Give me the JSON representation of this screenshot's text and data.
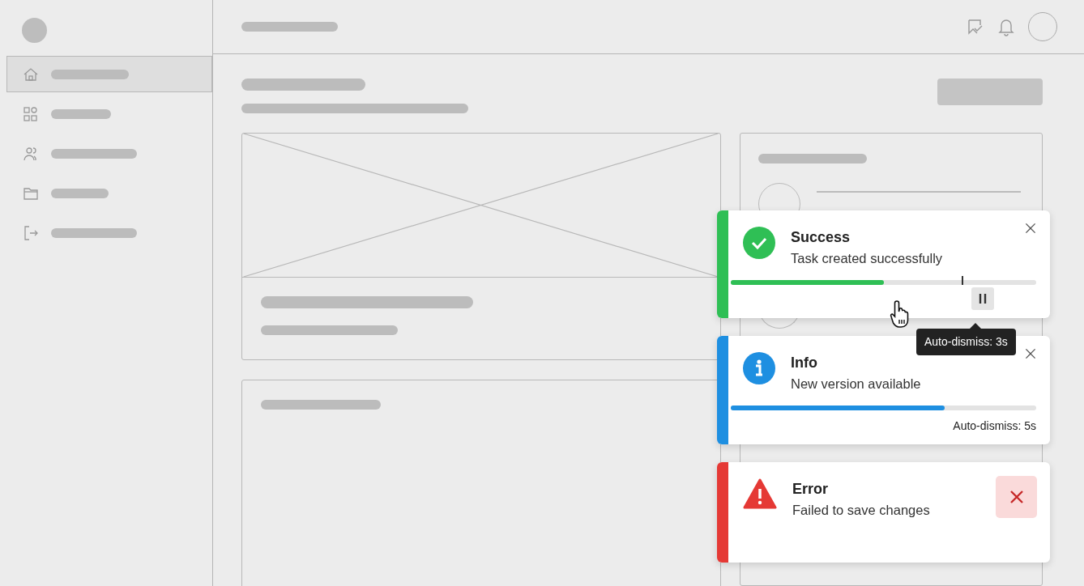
{
  "sidebar": {
    "items": [
      {
        "kind": "home",
        "selected": true
      },
      {
        "kind": "grid",
        "selected": false
      },
      {
        "kind": "users",
        "selected": false
      },
      {
        "kind": "folder",
        "selected": false
      },
      {
        "kind": "logout",
        "selected": false
      }
    ]
  },
  "toasts": [
    {
      "kind": "success",
      "color": "#2fbf55",
      "title": "Success",
      "message": "Task created successfully",
      "level": 0.5,
      "has_pause": true,
      "close_highlighted": false,
      "tooltip": "Auto-dismiss: 3s"
    },
    {
      "kind": "info",
      "color": "#1e8fe1",
      "title": "Info",
      "message": "New version available",
      "level": 0.7,
      "has_pause": false,
      "close_highlighted": false,
      "caption": "Auto-dismiss: 5s"
    },
    {
      "kind": "error",
      "color": "#e53935",
      "title": "Error",
      "message": "Failed to save changes",
      "close_highlighted": true
    }
  ]
}
